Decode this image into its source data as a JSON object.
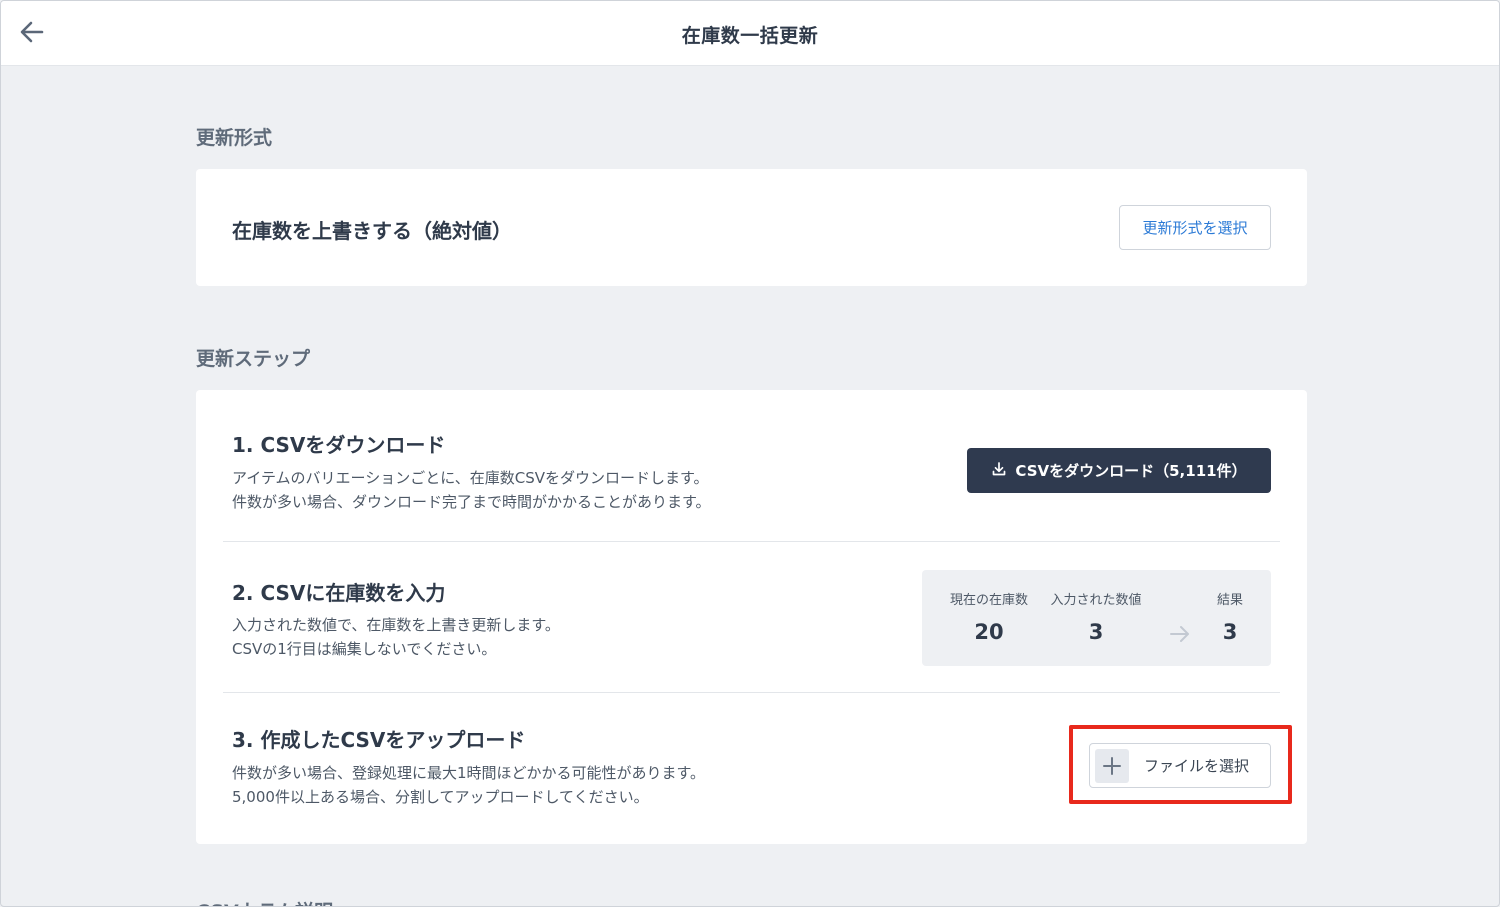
{
  "header": {
    "title": "在庫数一括更新",
    "back_icon": "arrow-left-icon"
  },
  "format_section": {
    "label": "更新形式",
    "current_value": "在庫数を上書きする（絶対値）",
    "select_button": "更新形式を選択"
  },
  "steps_section": {
    "label": "更新ステップ",
    "steps": [
      {
        "title": "1. CSVをダウンロード",
        "desc_lines": [
          "アイテムのバリエーションごとに、在庫数CSVをダウンロードします。",
          "件数が多い場合、ダウンロード完了まで時間がかかることがあります。"
        ],
        "button": "CSVをダウンロード（5,111件）",
        "button_icon": "download-icon"
      },
      {
        "title": "2. CSVに在庫数を入力",
        "desc_lines": [
          "入力された数値で、在庫数を上書き更新します。",
          "CSVの1行目は編集しないでください。"
        ],
        "example": {
          "columns": [
            {
              "label": "現在の在庫数",
              "value": "20"
            },
            {
              "label": "入力された数値",
              "value": "3"
            },
            {
              "label": "結果",
              "value": "3"
            }
          ],
          "arrow_icon": "arrow-right-icon"
        }
      },
      {
        "title": "3. 作成したCSVをアップロード",
        "desc_lines": [
          "件数が多い場合、登録処理に最大1時間ほどかかる可能性があります。",
          "5,000件以上ある場合、分割してアップロードしてください。"
        ],
        "button": "ファイルを選択",
        "button_icon": "plus-icon"
      }
    ]
  },
  "next_section": {
    "label": "CSVカラム説明"
  },
  "colors": {
    "highlight": "#e8291c",
    "primary_dark": "#2f3a4f",
    "link_blue": "#2b7ad6",
    "background": "#eef0f3"
  }
}
